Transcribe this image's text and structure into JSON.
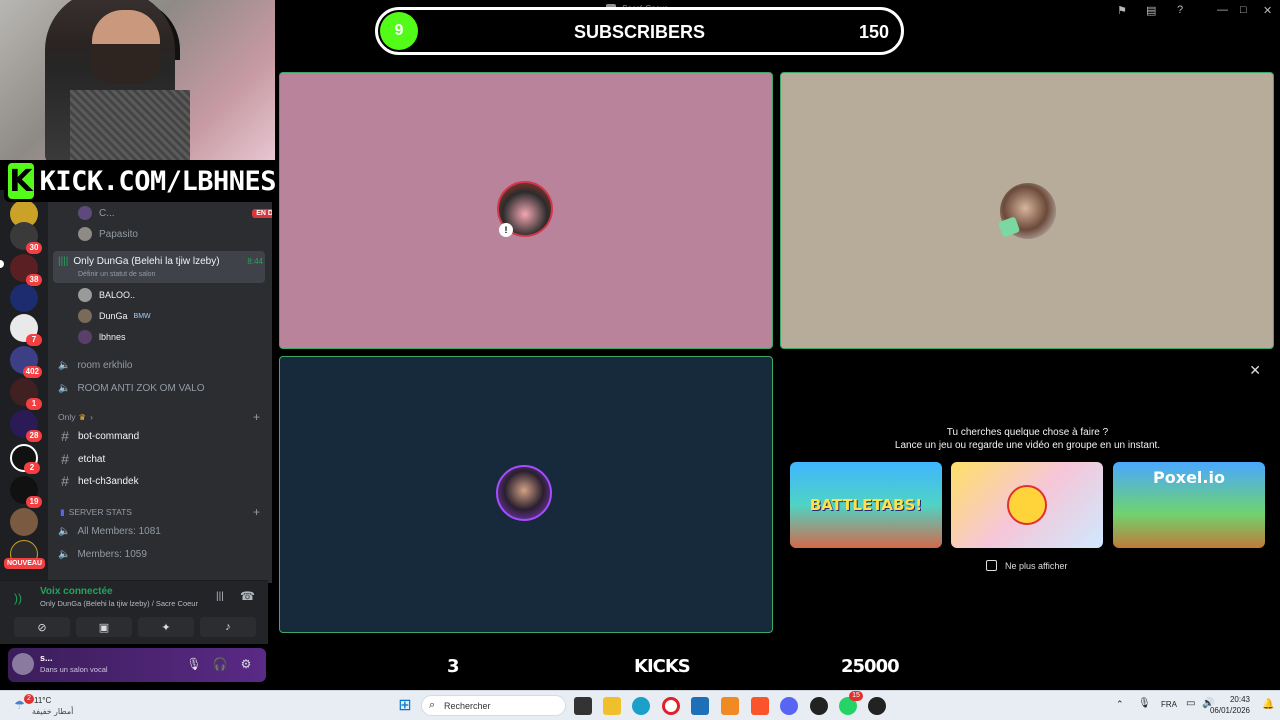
{
  "window": {
    "title": "Sacré Coeur"
  },
  "overlay": {
    "kick_url": "KICK.COM/LBHNES",
    "subscribers": {
      "current": "9",
      "label": "SUBSCRIBERS",
      "goal": "150"
    },
    "bottom_stats": {
      "count": "3",
      "label": "KICKS",
      "goal": "25000"
    }
  },
  "servers": [
    {
      "badge": "30"
    },
    {
      "badge": "38"
    },
    {
      "badge": ""
    },
    {
      "badge": "7"
    },
    {
      "badge": "402"
    },
    {
      "badge": "1"
    },
    {
      "badge": "28"
    },
    {
      "badge": "2"
    },
    {
      "badge": "19"
    },
    {
      "badge": ""
    },
    {
      "badge": "NOUVEAU"
    }
  ],
  "channels": {
    "above_users": [
      {
        "name": "C...",
        "live": "EN DIRECT"
      },
      {
        "name": "Papasito"
      }
    ],
    "active_voice": {
      "name": "Only DunGa (Belehi la tjiw lzeby)",
      "timer": "8:44",
      "status_hint": "Définir un statut de salon"
    },
    "voice_users": [
      {
        "name": "BALOO.."
      },
      {
        "name": "DunGa",
        "tag": "BMW"
      },
      {
        "name": "lbhnes"
      }
    ],
    "voice_channels": [
      "room erkhilo",
      "ROOM ANTI ZOK OM VALO"
    ],
    "category_only": "Only",
    "text_channels": [
      "bot-command",
      "etchat",
      "het-ch3andek"
    ],
    "category_stats": "SERVER STATS",
    "stats_channels": [
      "All Members: 1081",
      "Members: 1059"
    ]
  },
  "voice_panel": {
    "title": "Voix connectée",
    "subtitle": "Only DunGa (Belehi la tjiw lzeby) / Sacre Coeur"
  },
  "user_panel": {
    "name": "s...",
    "status": "Dans un salon vocal"
  },
  "activity": {
    "line1": "Tu cherches quelque chose à faire ?",
    "line2": "Lance un jeu ou regarde une vidéo en groupe en un instant.",
    "games": [
      "BATTLETABS!",
      "",
      "Poxel.io"
    ],
    "checkbox_label": "Ne plus afficher"
  },
  "taskbar": {
    "temp": "11°C",
    "weather": "أمطار خفيفة",
    "search_placeholder": "Rechercher",
    "lang": "FRA",
    "time": "20:43",
    "date": "06/01/2026",
    "notif_badge": "2",
    "whatsapp_badge": "15"
  },
  "colors": {
    "kick_green": "#53fc18",
    "tile_pink": "#b9839b",
    "tile_beige": "#b7ab9a",
    "tile_navy": "#172a3b",
    "discord_green": "#23a55a",
    "live_red": "#da373c"
  }
}
